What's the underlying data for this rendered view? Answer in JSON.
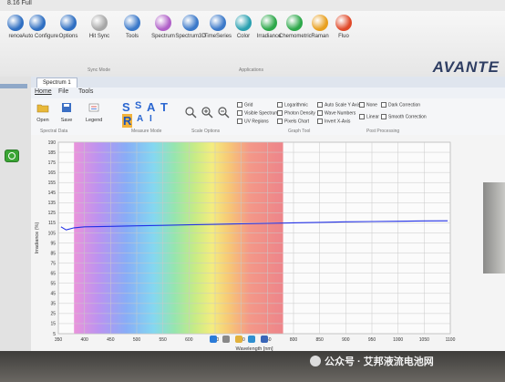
{
  "window": {
    "title": "8.16 Full"
  },
  "ribbon": {
    "buttons": [
      {
        "label": "rence",
        "color": "#2f6fc2"
      },
      {
        "label": "Auto Configure",
        "color": "#2f6fc2"
      },
      {
        "label": "Options",
        "color": "#2f6fc2"
      },
      {
        "label": "Hit Sync",
        "color": "#a7a7a7"
      },
      {
        "label": "Tools",
        "color": "#3b79c9"
      },
      {
        "label": "Spectrum",
        "color": "#b060c8"
      },
      {
        "label": "Spectrum3D",
        "color": "#3b79c9"
      },
      {
        "label": "TimeSeries",
        "color": "#3b79c9"
      },
      {
        "label": "Color",
        "color": "#2aa0b0"
      },
      {
        "label": "Irradiance",
        "color": "#2da84a"
      },
      {
        "label": "Chemometric",
        "color": "#2da84a"
      },
      {
        "label": "Raman",
        "color": "#e8a020"
      },
      {
        "label": "Fluo",
        "color": "#e04a2a"
      }
    ],
    "groups": [
      "Sync Mode",
      "Applications"
    ],
    "brand": "AVANTE"
  },
  "tabs": {
    "document": "Spectrum 1",
    "menu": [
      "Home",
      "File",
      "Tools"
    ]
  },
  "subribbon": {
    "buttons": [
      "Open",
      "Save",
      "Legend"
    ],
    "measure_letters": [
      "S",
      "S",
      "A",
      "T",
      "R",
      "A",
      "I"
    ],
    "groups": [
      "Spectral Data",
      "Measure Mode",
      "Scale Options",
      "Graph Tool",
      "Post Processing"
    ],
    "checks": [
      "Grid",
      "Visible Spectrum",
      "UV Regions",
      "Logarithmic",
      "Photon Density",
      "Pixels Chart",
      "Auto Scale Y Axis",
      "Wave Numbers",
      "Invert X-Axis",
      "None",
      "Dark Correction",
      "Linear",
      "Smooth Correction"
    ]
  },
  "chart_data": {
    "type": "line",
    "ylabel": "Irradiance (%)",
    "xlabel": "Wavelength [nm]",
    "ylim": [
      0,
      190
    ],
    "xlim": [
      350,
      1100
    ],
    "yticks": [
      "190",
      "185",
      "175",
      "165",
      "155",
      "145",
      "135",
      "125",
      "115",
      "105",
      "95",
      "85",
      "75",
      "65",
      "55",
      "45",
      "35",
      "25",
      "15",
      "5"
    ],
    "xticks": [
      "350",
      "400",
      "450",
      "500",
      "550",
      "600",
      "650",
      "700",
      "750",
      "800",
      "850",
      "900",
      "950",
      "1000",
      "1050",
      "1100"
    ],
    "grid": true,
    "series": [
      {
        "color": "#2230e6",
        "x": [
          355,
          365,
          380,
          400,
          450,
          500,
          550,
          600,
          650,
          700,
          750,
          800,
          850,
          900,
          950,
          1000,
          1050,
          1095
        ],
        "values": [
          106,
          103,
          105,
          106,
          106.5,
          107,
          107.5,
          108,
          108.5,
          109,
          109.5,
          110,
          110.5,
          111,
          111.3,
          111.6,
          111.9,
          112
        ]
      }
    ]
  },
  "watermark": {
    "text": "公众号 · 艾邦液流电池网"
  }
}
